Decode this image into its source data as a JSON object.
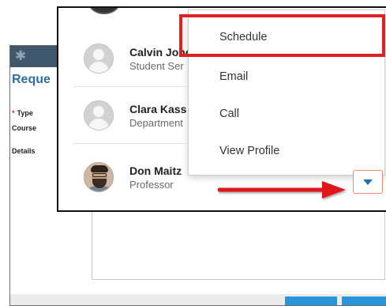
{
  "background_form": {
    "heading": "Reque",
    "fields": [
      {
        "label": "Type",
        "required": true
      },
      {
        "label": "Course",
        "required": false
      },
      {
        "label": "Details",
        "required": false
      }
    ]
  },
  "contacts": [
    {
      "name": "Calvin Johe",
      "role": "Student Ser",
      "avatar": "default-avatar"
    },
    {
      "name": "Clara Kass",
      "role": "Department",
      "avatar": "default-avatar"
    },
    {
      "name": "Don Maitz",
      "role": "Professor",
      "avatar": "photo-avatar"
    }
  ],
  "menu": {
    "items": [
      {
        "label": "Schedule",
        "highlighted": true
      },
      {
        "label": "Email"
      },
      {
        "label": "Call"
      },
      {
        "label": "View Profile"
      }
    ]
  },
  "colors": {
    "highlight": "#e12021",
    "titlebar": "#40586e",
    "heading": "#2f6da5",
    "caret": "#1d6fb3",
    "toggle_border": "#e58d6f"
  },
  "icons": {
    "dropdown_toggle": "caret-down-icon",
    "annotation": "red-arrow-icon"
  }
}
